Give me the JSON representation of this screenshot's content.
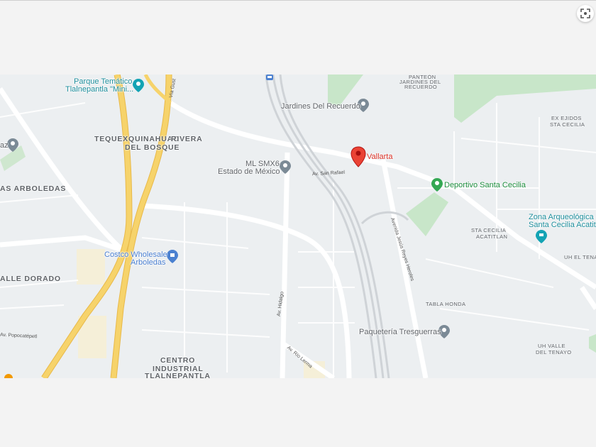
{
  "map": {
    "areas": {
      "tequex": "TEQUEXQUINAHUAC",
      "rivera1": "RIVERA",
      "rivera2": "DEL BOSQUE",
      "arboledas": "AS ARBOLEDAS",
      "valle_dorado": "ALLE DORADO",
      "centro1": "CENTRO",
      "centro2": "INDUSTRIAL",
      "centro3": "TLALNEPANTLA",
      "sta_cecilia1": "STA CECILIA",
      "sta_cecilia2": "ACATITLAN",
      "tabla_honda": "TABLA HONDA",
      "uh_valle1": "UH VALLE",
      "uh_valle2": "DEL TENAYO",
      "uh_el_ten": "UH EL TENA",
      "ex_ejidos1": "EX EJIDOS",
      "ex_ejidos2": "STA CECILIA",
      "panteon1": "PANTEÓN",
      "panteon2": "JARDINES DEL",
      "panteon3": "RECUERDO"
    },
    "places": {
      "parque1": "Parque Temático",
      "parque2": "Tlalnepantla \"Mini...",
      "jardines": "Jardines Del Recuerdo",
      "vallarta": "Vallarta",
      "ml_smx1": "ML SMX6",
      "ml_smx2": "Estado de México",
      "deportivo": "Deportivo Santa Cecilia",
      "zona1": "Zona Arqueológica",
      "zona2": "Santa Cecilia Acatitl",
      "costco1": "Costco Wholesale",
      "costco2": "Arboledas",
      "paqueteria": "Paquetería Tresguerras",
      "left_edge": "az"
    },
    "streets": {
      "san_rafael": "Av. San Rafael",
      "jesus_reyes": "Avenida Jesús Reyes Heroles",
      "hidalgo": "Av. Hidalgo",
      "rio_lerma": "Av. Río Lerma",
      "via_gust": "Vía Gust",
      "popocatepetl": "Av. Popocatépetl"
    },
    "colors": {
      "highway": "#f6d36b",
      "highway_edge": "#e8b94a",
      "road": "#ffffff",
      "park": "#c8e6c9",
      "marker_red": "#ea4335",
      "marker_blue": "#4a80d0",
      "marker_teal": "#13a3b4",
      "marker_gray": "#7b8a96",
      "marker_green": "#34a853"
    }
  },
  "controls": {
    "fullscreen_icon": "fullscreen-icon"
  }
}
